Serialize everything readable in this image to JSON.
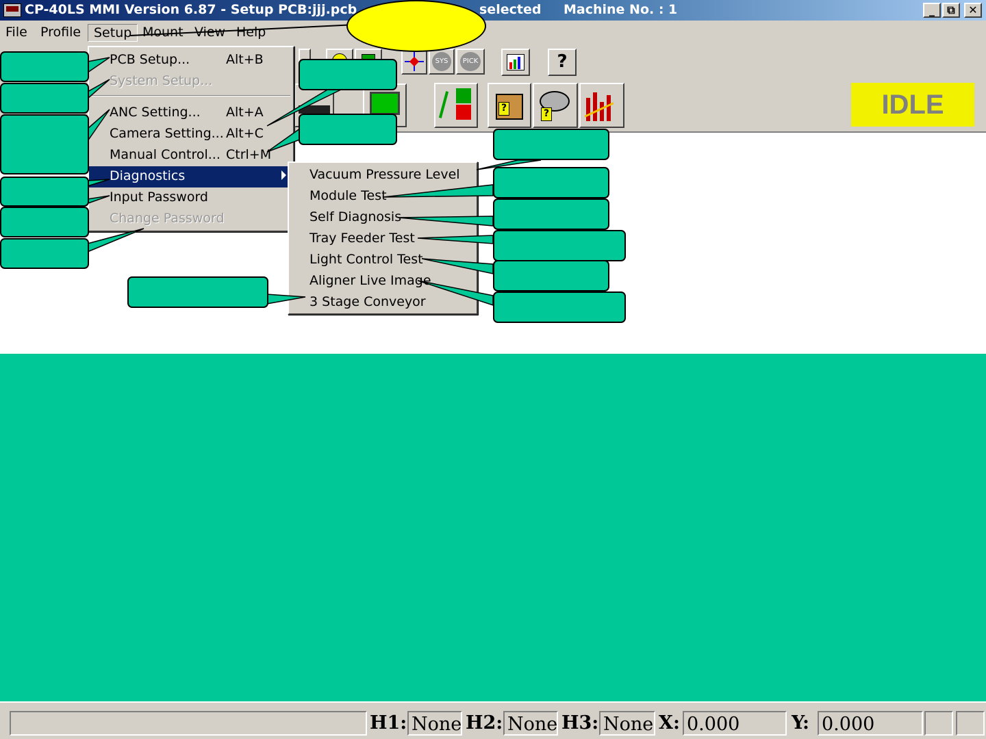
{
  "window": {
    "title": "CP-40LS MMI Version 6.87 - Setup PCB:jjj.pcb",
    "title_mid": "selected",
    "machine": "Machine No. : 1",
    "controls": [
      "_",
      "⧉",
      "✕"
    ]
  },
  "menubar": [
    "File",
    "Profile",
    "Setup",
    "Mount",
    "View",
    "Help"
  ],
  "status_indicator": "IDLE",
  "setup_menu": [
    {
      "label": "PCB Setup...",
      "shortcut": "Alt+B",
      "state": "enabled"
    },
    {
      "label": "System Setup...",
      "shortcut": "",
      "state": "disabled"
    },
    {
      "label": "ANC Setting...",
      "shortcut": "Alt+A",
      "state": "enabled"
    },
    {
      "label": "Camera Setting...",
      "shortcut": "Alt+C",
      "state": "enabled"
    },
    {
      "label": "Manual Control...",
      "shortcut": "Ctrl+M",
      "state": "enabled"
    },
    {
      "label": "Diagnostics",
      "shortcut": "",
      "state": "selected",
      "submenu": true
    },
    {
      "label": "Input Password",
      "shortcut": "",
      "state": "enabled"
    },
    {
      "label": "Change Password",
      "shortcut": "",
      "state": "disabled"
    }
  ],
  "diagnostics_menu": [
    "Vacuum Pressure Level",
    "Module Test",
    "Self Diagnosis",
    "Tray Feeder Test",
    "Light Control Test",
    "Aligner Live Image",
    "3 Stage Conveyor"
  ],
  "statusbar": {
    "h1_label": "H1:",
    "h1_value": "None",
    "h2_label": "H2:",
    "h2_value": "None",
    "h3_label": "H3:",
    "h3_value": "None",
    "x_label": "X:",
    "x_value": "0.000",
    "y_label": "Y:",
    "y_value": "0.000"
  },
  "colors": {
    "callout": "#00c896",
    "idle_bg": "#f2f200",
    "highlight": "#0a246a",
    "oval": "#ffff00"
  },
  "icons": [
    "pcb-board-icon",
    "smile-icon",
    "green-chip-icon",
    "crosshair-icon",
    "sys-icon",
    "pick-icon",
    "chart-image-icon",
    "help-icon",
    "feeder-icon",
    "monitor-icon",
    "io-test-icon",
    "parts-box-icon",
    "tape-reel-icon",
    "statistics-chart-icon"
  ]
}
